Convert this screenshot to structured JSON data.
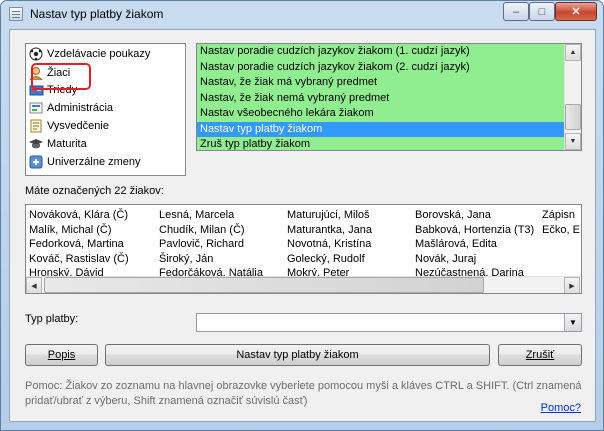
{
  "window": {
    "title": "Nastav typ platby žiakom"
  },
  "titlebar_buttons": {
    "minimize": "–",
    "maximize": "□",
    "close": "✕"
  },
  "tree": {
    "items": [
      {
        "label": "Vzdelávacie poukazy",
        "icon": "ball-icon"
      },
      {
        "label": "Žiaci",
        "icon": "student-icon"
      },
      {
        "label": "Triedy",
        "icon": "class-icon"
      },
      {
        "label": "Administrácia",
        "icon": "admin-icon"
      },
      {
        "label": "Vysvedčenie",
        "icon": "certificate-icon"
      },
      {
        "label": "Maturita",
        "icon": "graduation-icon"
      },
      {
        "label": "Univerzálne zmeny",
        "icon": "changes-icon"
      }
    ]
  },
  "actions": {
    "items": [
      {
        "label": "Nastav poradie cudzích jazykov žiakom (1. cudzí jazyk)",
        "selected": false
      },
      {
        "label": "Nastav poradie cudzích jazykov žiakom (2. cudzí jazyk)",
        "selected": false
      },
      {
        "label": "Nastav, že žiak má vybraný predmet",
        "selected": false
      },
      {
        "label": "Nastav, že žiak nemá vybraný predmet",
        "selected": false
      },
      {
        "label": "Nastav všeobecného lekára žiakom",
        "selected": false
      },
      {
        "label": "Nastav typ platby žiakom",
        "selected": true
      },
      {
        "label": "Zruš typ platby žiakom",
        "selected": false
      }
    ]
  },
  "selected_label": "Máte označených 22 žiakov:",
  "students": {
    "columns": [
      [
        "Nováková, Klára (Č)",
        "Malík, Michal (Č)",
        "Fedorková, Martina",
        "Kováč, Rastislav (Č)",
        "Hronský, Dávid"
      ],
      [
        "Lesná, Marcela",
        "Chudík, Milan (Č)",
        "Pavlovič, Richard",
        "Široký, Ján",
        "Fedorčáková, Natália"
      ],
      [
        "Maturujúci, Miloš",
        "Maturantka, Jana",
        "Novotná, Kristína",
        "Golecký, Rudolf",
        "Mokrý, Peter"
      ],
      [
        "Borovská, Jana",
        "Babková, Hortenzia (T3)",
        "Mašlárová, Edita",
        "Novák, Juraj",
        "Nezúčastnená, Darina"
      ],
      [
        "Zápisn",
        "Ečko, E"
      ]
    ]
  },
  "payment_type": {
    "label": "Typ platby:",
    "value": ""
  },
  "buttons": {
    "popis": "Popis",
    "apply": "Nastav typ platby žiakom",
    "cancel": "Zrušiť"
  },
  "help_text": "Pomoc: Žiakov zo zoznamu na hlavnej obrazovke vyberiete pomocou myši a kláves CTRL a SHIFT. (Ctrl znamená pridať/ubrať z výberu, Shift znamená označiť súvislú časť)",
  "help_link": "Pomoc?",
  "colors": {
    "green": "#90ee90",
    "selected": "#3399ff",
    "highlight": "#e0202a"
  }
}
